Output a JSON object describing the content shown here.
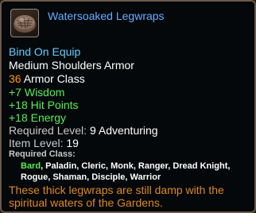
{
  "item": {
    "name": "Watersoaked Legwraps",
    "icon": "legwraps-icon"
  },
  "bind": "Bind On Equip",
  "armor_type": "Medium Shoulders Armor",
  "armor_class": {
    "value": "36",
    "label": " Armor Class"
  },
  "stats": [
    "+7 Wisdom",
    "+18 Hit Points",
    "+18 Energy"
  ],
  "required_level": {
    "label": "Required Level:",
    "value": " 9 Adventuring"
  },
  "item_level": {
    "label": "Item Level:",
    "value": " 19"
  },
  "required_class": {
    "label": "Required Class:",
    "current": "Bard",
    "line1_rest": ", Paladin, Cleric, Monk, Ranger, Dread Knight,",
    "line2": "Rogue, Shaman, Disciple, Warrior"
  },
  "description": [
    "These thick legwraps are still damp with the",
    "spiritual waters of the Gardens."
  ],
  "colors": {
    "name": "#66aaff",
    "bind": "#66ccff",
    "armor_value": "#ff9900",
    "stats": "#55ee55",
    "current_class": "#55ee55",
    "description": "#dd8822"
  }
}
